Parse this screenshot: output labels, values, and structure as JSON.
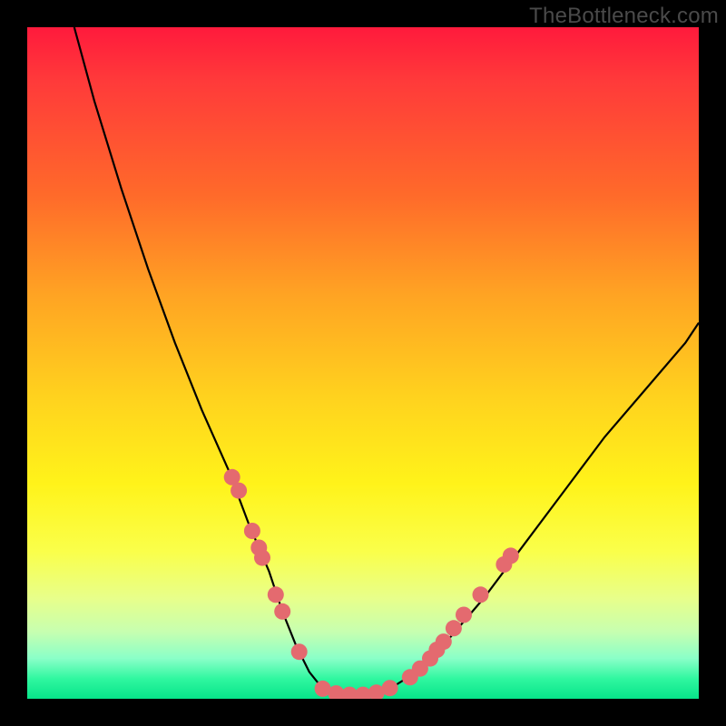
{
  "watermark": "TheBottleneck.com",
  "chart_data": {
    "type": "line",
    "title": "",
    "xlabel": "",
    "ylabel": "",
    "xlim": [
      0,
      100
    ],
    "ylim": [
      0,
      100
    ],
    "series": [
      {
        "name": "bottleneck-curve",
        "x": [
          7,
          10,
          14,
          18,
          22,
          26,
          30,
          33,
          36,
          38,
          40,
          42,
          44,
          46,
          50,
          54,
          58,
          62,
          68,
          74,
          80,
          86,
          92,
          98,
          100
        ],
        "y": [
          100,
          89,
          76,
          64,
          53,
          43,
          34,
          26,
          19,
          13,
          8,
          4,
          1.5,
          0.5,
          0.5,
          1.5,
          4,
          8,
          15,
          23,
          31,
          39,
          46,
          53,
          56
        ]
      }
    ],
    "markers": [
      {
        "x": 30.5,
        "y": 33
      },
      {
        "x": 31.5,
        "y": 31
      },
      {
        "x": 33.5,
        "y": 25
      },
      {
        "x": 34.5,
        "y": 22.5
      },
      {
        "x": 35,
        "y": 21
      },
      {
        "x": 37,
        "y": 15.5
      },
      {
        "x": 38,
        "y": 13
      },
      {
        "x": 40.5,
        "y": 7
      },
      {
        "x": 44,
        "y": 1.5
      },
      {
        "x": 46,
        "y": 0.8
      },
      {
        "x": 48,
        "y": 0.6
      },
      {
        "x": 50,
        "y": 0.6
      },
      {
        "x": 52,
        "y": 0.9
      },
      {
        "x": 54,
        "y": 1.6
      },
      {
        "x": 57,
        "y": 3.2
      },
      {
        "x": 58.5,
        "y": 4.5
      },
      {
        "x": 60,
        "y": 6
      },
      {
        "x": 61,
        "y": 7.3
      },
      {
        "x": 62,
        "y": 8.5
      },
      {
        "x": 63.5,
        "y": 10.5
      },
      {
        "x": 65,
        "y": 12.5
      },
      {
        "x": 67.5,
        "y": 15.5
      },
      {
        "x": 71,
        "y": 20
      },
      {
        "x": 72,
        "y": 21.3
      }
    ],
    "marker_color": "#e46a6f",
    "marker_radius_px": 9,
    "gradient_stops": [
      {
        "pos": 0.0,
        "color": "#ff1a3c"
      },
      {
        "pos": 0.4,
        "color": "#ffa423"
      },
      {
        "pos": 0.68,
        "color": "#fff31a"
      },
      {
        "pos": 1.0,
        "color": "#07e48a"
      }
    ]
  }
}
